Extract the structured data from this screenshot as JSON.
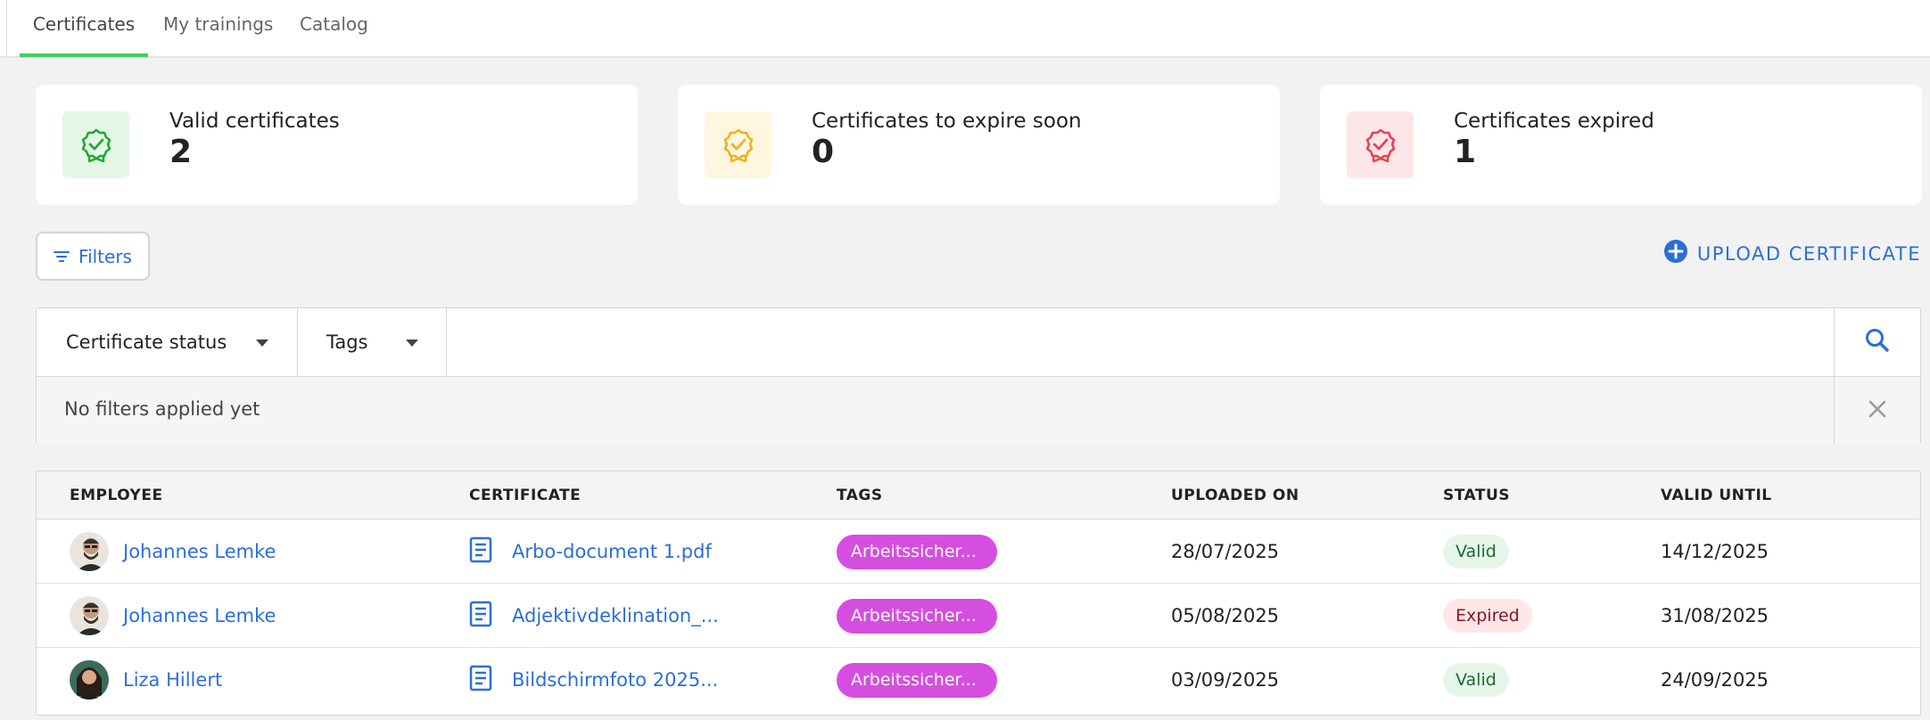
{
  "tabs": [
    {
      "label": "Certificates",
      "active": true
    },
    {
      "label": "My trainings",
      "active": false
    },
    {
      "label": "Catalog",
      "active": false
    }
  ],
  "summary": [
    {
      "label": "Valid certificates",
      "count": "2",
      "icon": "valid-certificate-icon",
      "color": "#22a834",
      "bg": "#e5f7e7"
    },
    {
      "label": "Certificates to expire soon",
      "count": "0",
      "icon": "expiring-certificate-icon",
      "color": "#f2b01e",
      "bg": "#fff6df"
    },
    {
      "label": "Certificates expired",
      "count": "1",
      "icon": "expired-certificate-icon",
      "color": "#e8414e",
      "bg": "#fde6e8"
    }
  ],
  "toolbar": {
    "filters_label": "Filters",
    "upload_label": "UPLOAD CERTIFICATE"
  },
  "filter_panel": {
    "status_select": "Certificate status",
    "tags_select": "Tags",
    "search_value": "",
    "empty_message": "No filters applied yet"
  },
  "table": {
    "columns": [
      "EMPLOYEE",
      "CERTIFICATE",
      "TAGS",
      "UPLOADED ON",
      "STATUS",
      "VALID UNTIL"
    ],
    "rows": [
      {
        "employee": "Johannes Lemke",
        "certificate": "Arbo-document 1.pdf",
        "tag": "Arbeitssicher...",
        "uploaded": "28/07/2025",
        "status": "Valid",
        "valid_until": "14/12/2025"
      },
      {
        "employee": "Johannes Lemke",
        "certificate": "Adjektivdeklination_...",
        "tag": "Arbeitssicher...",
        "uploaded": "05/08/2025",
        "status": "Expired",
        "valid_until": "31/08/2025"
      },
      {
        "employee": "Liza Hillert",
        "certificate": "Bildschirmfoto 2025...",
        "tag": "Arbeitssicher...",
        "uploaded": "03/09/2025",
        "status": "Valid",
        "valid_until": "24/09/2025"
      }
    ]
  },
  "colors": {
    "accent": "#2b6fd6",
    "active_tab": "#3fcf5c",
    "tag": "#d64ee0"
  }
}
